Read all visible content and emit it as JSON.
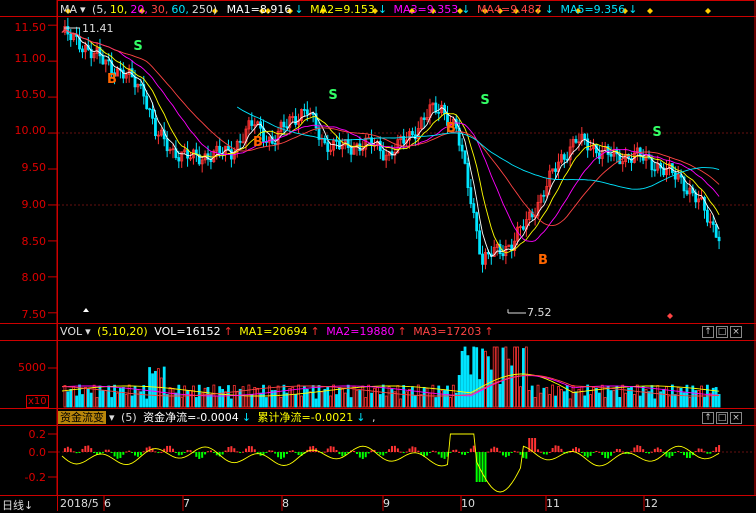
{
  "colors": {
    "up": "#ff3333",
    "down": "#00e5ff",
    "ma1": "#ffffff",
    "ma2": "#ffff00",
    "ma3": "#ff00ff",
    "ma4": "#ff4444",
    "ma5": "#00e5ff",
    "axis": "#cc0000",
    "flat": "#00ff00"
  },
  "price_panel": {
    "ma_label": "MA",
    "params_open": "(5,",
    "p1": "10,",
    "p2": "20,",
    "p3": "30,",
    "p4": "60,",
    "p5": "250)",
    "ma1": "MA1=8.916",
    "ma2": "MA2=9.153",
    "ma3": "MA3=9.353",
    "ma4": "MA4=9.487",
    "ma5": "MA5=9.356",
    "high_label": "11.41",
    "low_label": "7.52",
    "yticks": [
      "11.50",
      "11.00",
      "10.50",
      "10.00",
      "9.50",
      "9.00",
      "8.50",
      "8.00",
      "7.50"
    ],
    "b_signal": "B",
    "s_signal": "S"
  },
  "vol_panel": {
    "label": "VOL",
    "params": "(5,10,20)",
    "vol": "VOL=16152",
    "ma1": "MA1=20694",
    "ma2": "MA2=19880",
    "ma3": "MA3=17203",
    "ytick": "5000",
    "unit": "x10"
  },
  "fund_panel": {
    "selector": "资金流变",
    "param": "(5)",
    "net": "资金净流=-0.0004",
    "cum": "累计净流=-0.0021",
    "tail": ",",
    "yticks": [
      "0.2",
      "0.0",
      "-0.2"
    ]
  },
  "x_axis": {
    "period": "日线",
    "labels": [
      "2018/5",
      "6",
      "7",
      "8",
      "9",
      "10",
      "11",
      "12"
    ]
  },
  "chart_data": {
    "type": "candlestick",
    "ylim": [
      7.4,
      11.6
    ],
    "high": 11.41,
    "low": 7.52
  }
}
